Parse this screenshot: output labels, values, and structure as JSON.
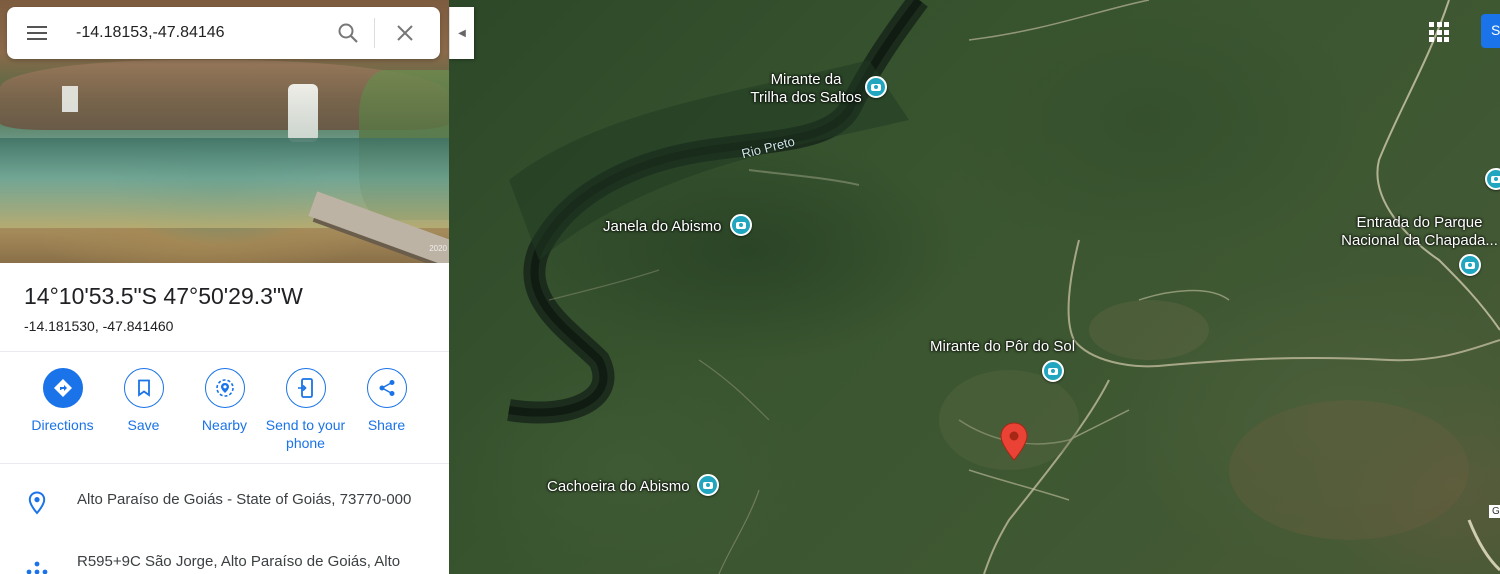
{
  "search": {
    "value": "-14.18153,-47.84146"
  },
  "place": {
    "title": "14°10'53.5\"S 47°50'29.3\"W",
    "decimal": "-14.181530, -47.841460",
    "photo_credit": "2020"
  },
  "actions": [
    {
      "label": "Directions",
      "icon": "directions-icon"
    },
    {
      "label": "Save",
      "icon": "bookmark-icon"
    },
    {
      "label": "Nearby",
      "icon": "nearby-icon"
    },
    {
      "label": "Send to your phone",
      "icon": "phone-icon"
    },
    {
      "label": "Share",
      "icon": "share-icon"
    }
  ],
  "details": [
    {
      "icon": "location-pin-icon",
      "text": "Alto Paraíso de Goiás - State of Goiás, 73770-000"
    },
    {
      "icon": "plus-code-icon",
      "text": "R595+9C São Jorge, Alto Paraíso de Goiás, Alto"
    }
  ],
  "map": {
    "labels": {
      "mirante_saltos": "Mirante da\nTrilha dos Saltos",
      "rio_preto": "Rio Preto",
      "janela": "Janela do Abismo",
      "entrada": "Entrada do Parque\nNacional da Chapada...",
      "mirante_por_do_sol": "Mirante do Pôr do Sol",
      "cachoeira": "Cachoeira do Abismo"
    },
    "signin_letter": "S",
    "scale_fragment": "G",
    "pin_color": "#ea4335",
    "poi_color": "#22a6c0"
  },
  "colors": {
    "accent": "#1a73e8"
  }
}
